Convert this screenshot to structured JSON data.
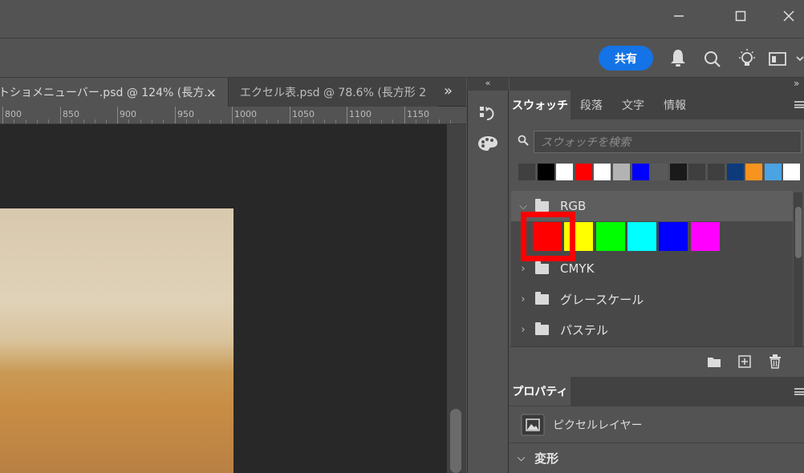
{
  "window": {
    "minimize_icon": "minimize-icon",
    "maximize_icon": "maximize-icon",
    "close_icon": "close-icon"
  },
  "header": {
    "share_label": "共有",
    "icons": [
      "bell-icon",
      "search-icon",
      "lightbulb-icon",
      "workspace-icon",
      "chevron-down-icon"
    ]
  },
  "tabs": [
    {
      "label": "トショメニューバー.psd @ 124% (長方...",
      "close": "×"
    },
    {
      "label": "エクセル表.psd @ 78.6% (長方形 2"
    }
  ],
  "tabs_overflow": "»",
  "ruler": {
    "labels": [
      "800",
      "850",
      "900",
      "950",
      "1000",
      "1050",
      "1100",
      "1150"
    ]
  },
  "strip": {
    "collapse": "«"
  },
  "panel": {
    "collapse": "»",
    "swatch_tabs": [
      "スウォッチ",
      "段落",
      "文字",
      "情報"
    ],
    "search_placeholder": "スウォッチを検索",
    "recent_swatches": [
      "#404040",
      "#000000",
      "#ffffff",
      "#ff0000",
      "#ffffff",
      "#b3b3b3",
      "#0000ff",
      "#595959",
      "#1a1a1a",
      "#3f3f3f",
      "#3f3f3f",
      "#0c3a7a",
      "#f7931e",
      "#4ba3e3",
      "#ffffff"
    ],
    "groups": [
      {
        "name": "RGB",
        "expanded": true,
        "swatches": [
          "#ff0000",
          "#ffff00",
          "#00ff00",
          "#00ffff",
          "#0000ff",
          "#ff00ff"
        ]
      },
      {
        "name": "CMYK",
        "expanded": false
      },
      {
        "name": "グレースケール",
        "expanded": false
      },
      {
        "name": "パステル",
        "expanded": false
      }
    ],
    "properties_tab": "プロパティ",
    "layer_type": "ピクセルレイヤー",
    "transform_label": "変形"
  },
  "colors": {
    "accent": "#1473e6",
    "highlight": "#ff0000"
  }
}
